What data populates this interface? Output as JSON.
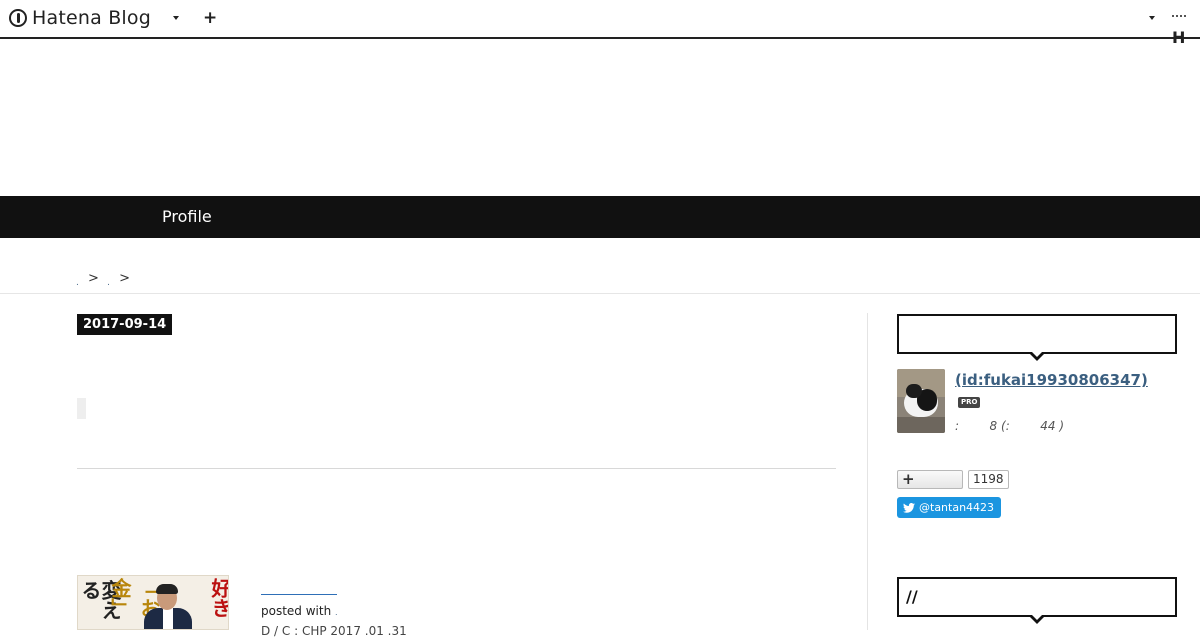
{
  "header": {
    "brand": "Hatena Blog",
    "add_label": "+",
    "right_brand": "H"
  },
  "nav": {
    "items": [
      "Profile"
    ]
  },
  "breadcrumb": {
    "separator": ">"
  },
  "entry": {
    "date": "2017-09-14",
    "posted_with": "posted with",
    "book_cover_text": {
      "left": "変える",
      "middle_a": "「",
      "middle_b": "お金",
      "middle_c": "」",
      "right": "好き"
    },
    "cut_text": "D / C : CHP 2017 .01 .31"
  },
  "sidebar": {
    "profile_box_title": "",
    "user_name": "(id:fukai19930806347)",
    "pro_badge": "PRO",
    "reader_stats": ":        8 (:        44 )",
    "bookmark_count": "1198",
    "twitter_handle": "@tantan4423",
    "second_box_title": "//"
  },
  "colors": {
    "nav_background": "#111111",
    "link_blue": "#3b5f80",
    "twitter_blue": "#1b95e0",
    "badge_dark": "#111111"
  },
  "icons": {
    "brand": "hatena-logo-icon",
    "add": "plus-icon",
    "menu": "chevron-down-icon",
    "bookmark": "plus-icon",
    "twitter": "twitter-bird-icon"
  }
}
